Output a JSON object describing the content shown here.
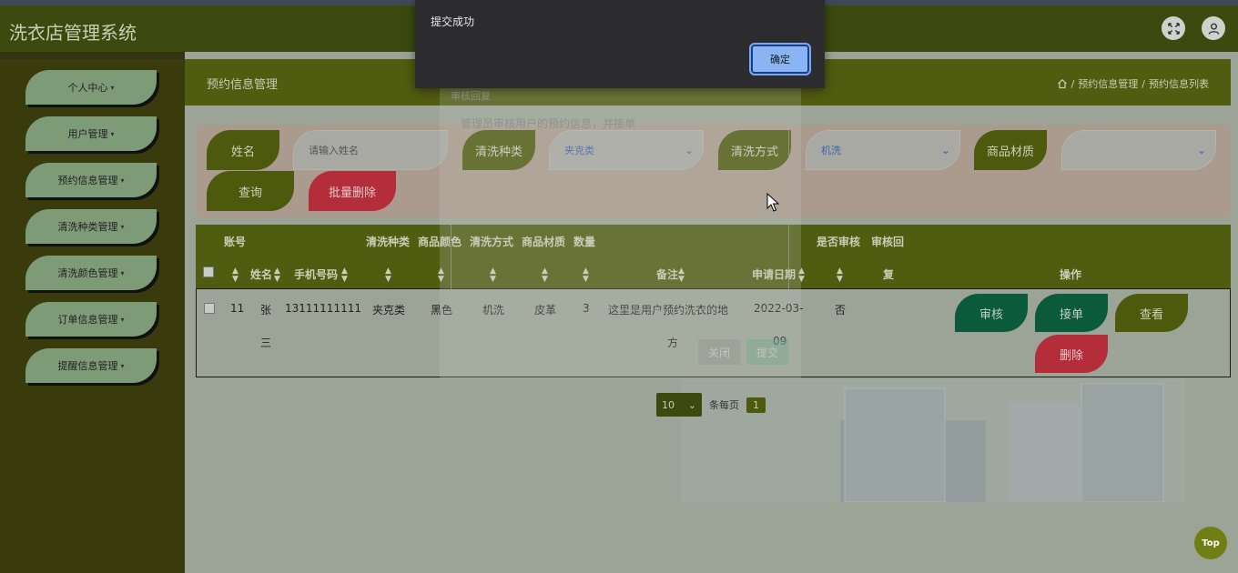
{
  "app": {
    "title": "洗衣店管理系统"
  },
  "sidebar": {
    "items": [
      {
        "label": "个人中心"
      },
      {
        "label": "用户管理"
      },
      {
        "label": "预约信息管理"
      },
      {
        "label": "清洗种类管理"
      },
      {
        "label": "清洗颜色管理"
      },
      {
        "label": "订单信息管理"
      },
      {
        "label": "提醒信息管理"
      }
    ]
  },
  "page": {
    "title": "预约信息管理"
  },
  "breadcrumb": {
    "items": [
      "预约信息管理",
      "预约信息列表"
    ],
    "separator": "/"
  },
  "search": {
    "name_label": "姓名",
    "name_placeholder": "请输入姓名",
    "category_label": "清洗种类",
    "category_value": "夹克类",
    "method_label": "清洗方式",
    "method_value": "机洗",
    "material_label": "商品材质",
    "material_value": "",
    "query_button": "查询",
    "batch_delete_button": "批量删除"
  },
  "table": {
    "headers": {
      "account": "账号",
      "name": "姓名",
      "phone": "手机号码",
      "category": "清洗种类",
      "color": "商品颜色",
      "method": "清洗方式",
      "material": "商品材质",
      "quantity": "数量",
      "remark": "备注",
      "date": "申请日期",
      "reviewed": "是否审核",
      "reply_1": "审核回",
      "reply_2": "复",
      "actions": "操作"
    },
    "rows": [
      {
        "account": "11",
        "name_1": "张",
        "name_2": "三",
        "phone": "13111111111",
        "category": "夹克类",
        "color": "黑色",
        "method": "机洗",
        "material": "皮革",
        "quantity": "3",
        "remark_1": "这里是用户预约洗衣的地",
        "remark_2": "方",
        "date_1": "2022-03-",
        "date_2": "09",
        "reviewed": "否",
        "reply": ""
      }
    ],
    "row_actions": {
      "review": "审核",
      "accept": "接单",
      "view": "查看",
      "delete": "删除"
    }
  },
  "pagination": {
    "page_size": "10",
    "page_size_label": "条每页",
    "current_page": "1"
  },
  "review_dialog": {
    "title": "审核回复",
    "textarea_text": "管理员审核用户的预约信息，并接单",
    "close_button": "关闭",
    "submit_button": "提交"
  },
  "alert": {
    "message": "提交成功",
    "confirm_button": "确定"
  },
  "back_to_top": {
    "label": "Top"
  },
  "colors": {
    "header": "#3c4a10",
    "sidebar": "#3a3b0c",
    "accent_olive": "#4d5a0e",
    "accent_red": "#b32d3a",
    "accent_teal": "#0c5a3c"
  },
  "icons": [
    "fullscreen-icon",
    "user-icon",
    "home-icon",
    "chevron-down-icon",
    "sort-icon"
  ]
}
